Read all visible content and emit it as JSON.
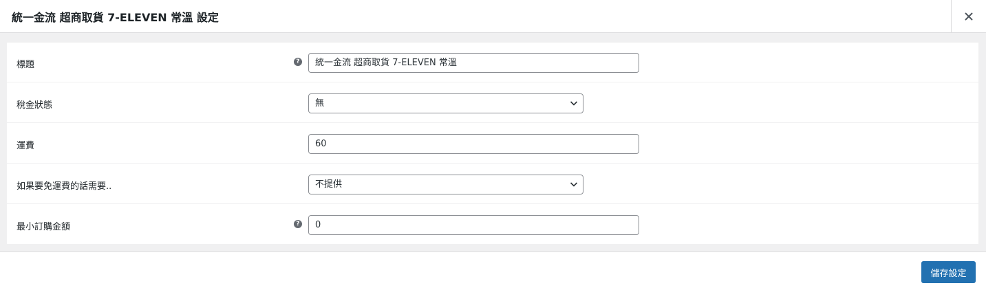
{
  "modal": {
    "title": "統一金流 超商取貨 7-ELEVEN 常溫 設定",
    "close_icon": "close-icon"
  },
  "settings": {
    "title_field": {
      "label": "標題",
      "value": "統一金流 超商取貨 7-ELEVEN 常溫",
      "help_icon": "help-icon"
    },
    "tax_status": {
      "label": "稅金狀態",
      "value": "無"
    },
    "shipping_cost": {
      "label": "運費",
      "value": "60"
    },
    "free_shipping_requires": {
      "label": "如果要免運費的話需要..",
      "value": "不提供"
    },
    "min_order_amount": {
      "label": "最小訂購金額",
      "value": "0",
      "help_icon": "help-icon"
    }
  },
  "footer": {
    "save_label": "儲存設定"
  },
  "colors": {
    "primary_button": "#2271b1",
    "border": "#8c8f94",
    "background": "#f0f0f1"
  }
}
